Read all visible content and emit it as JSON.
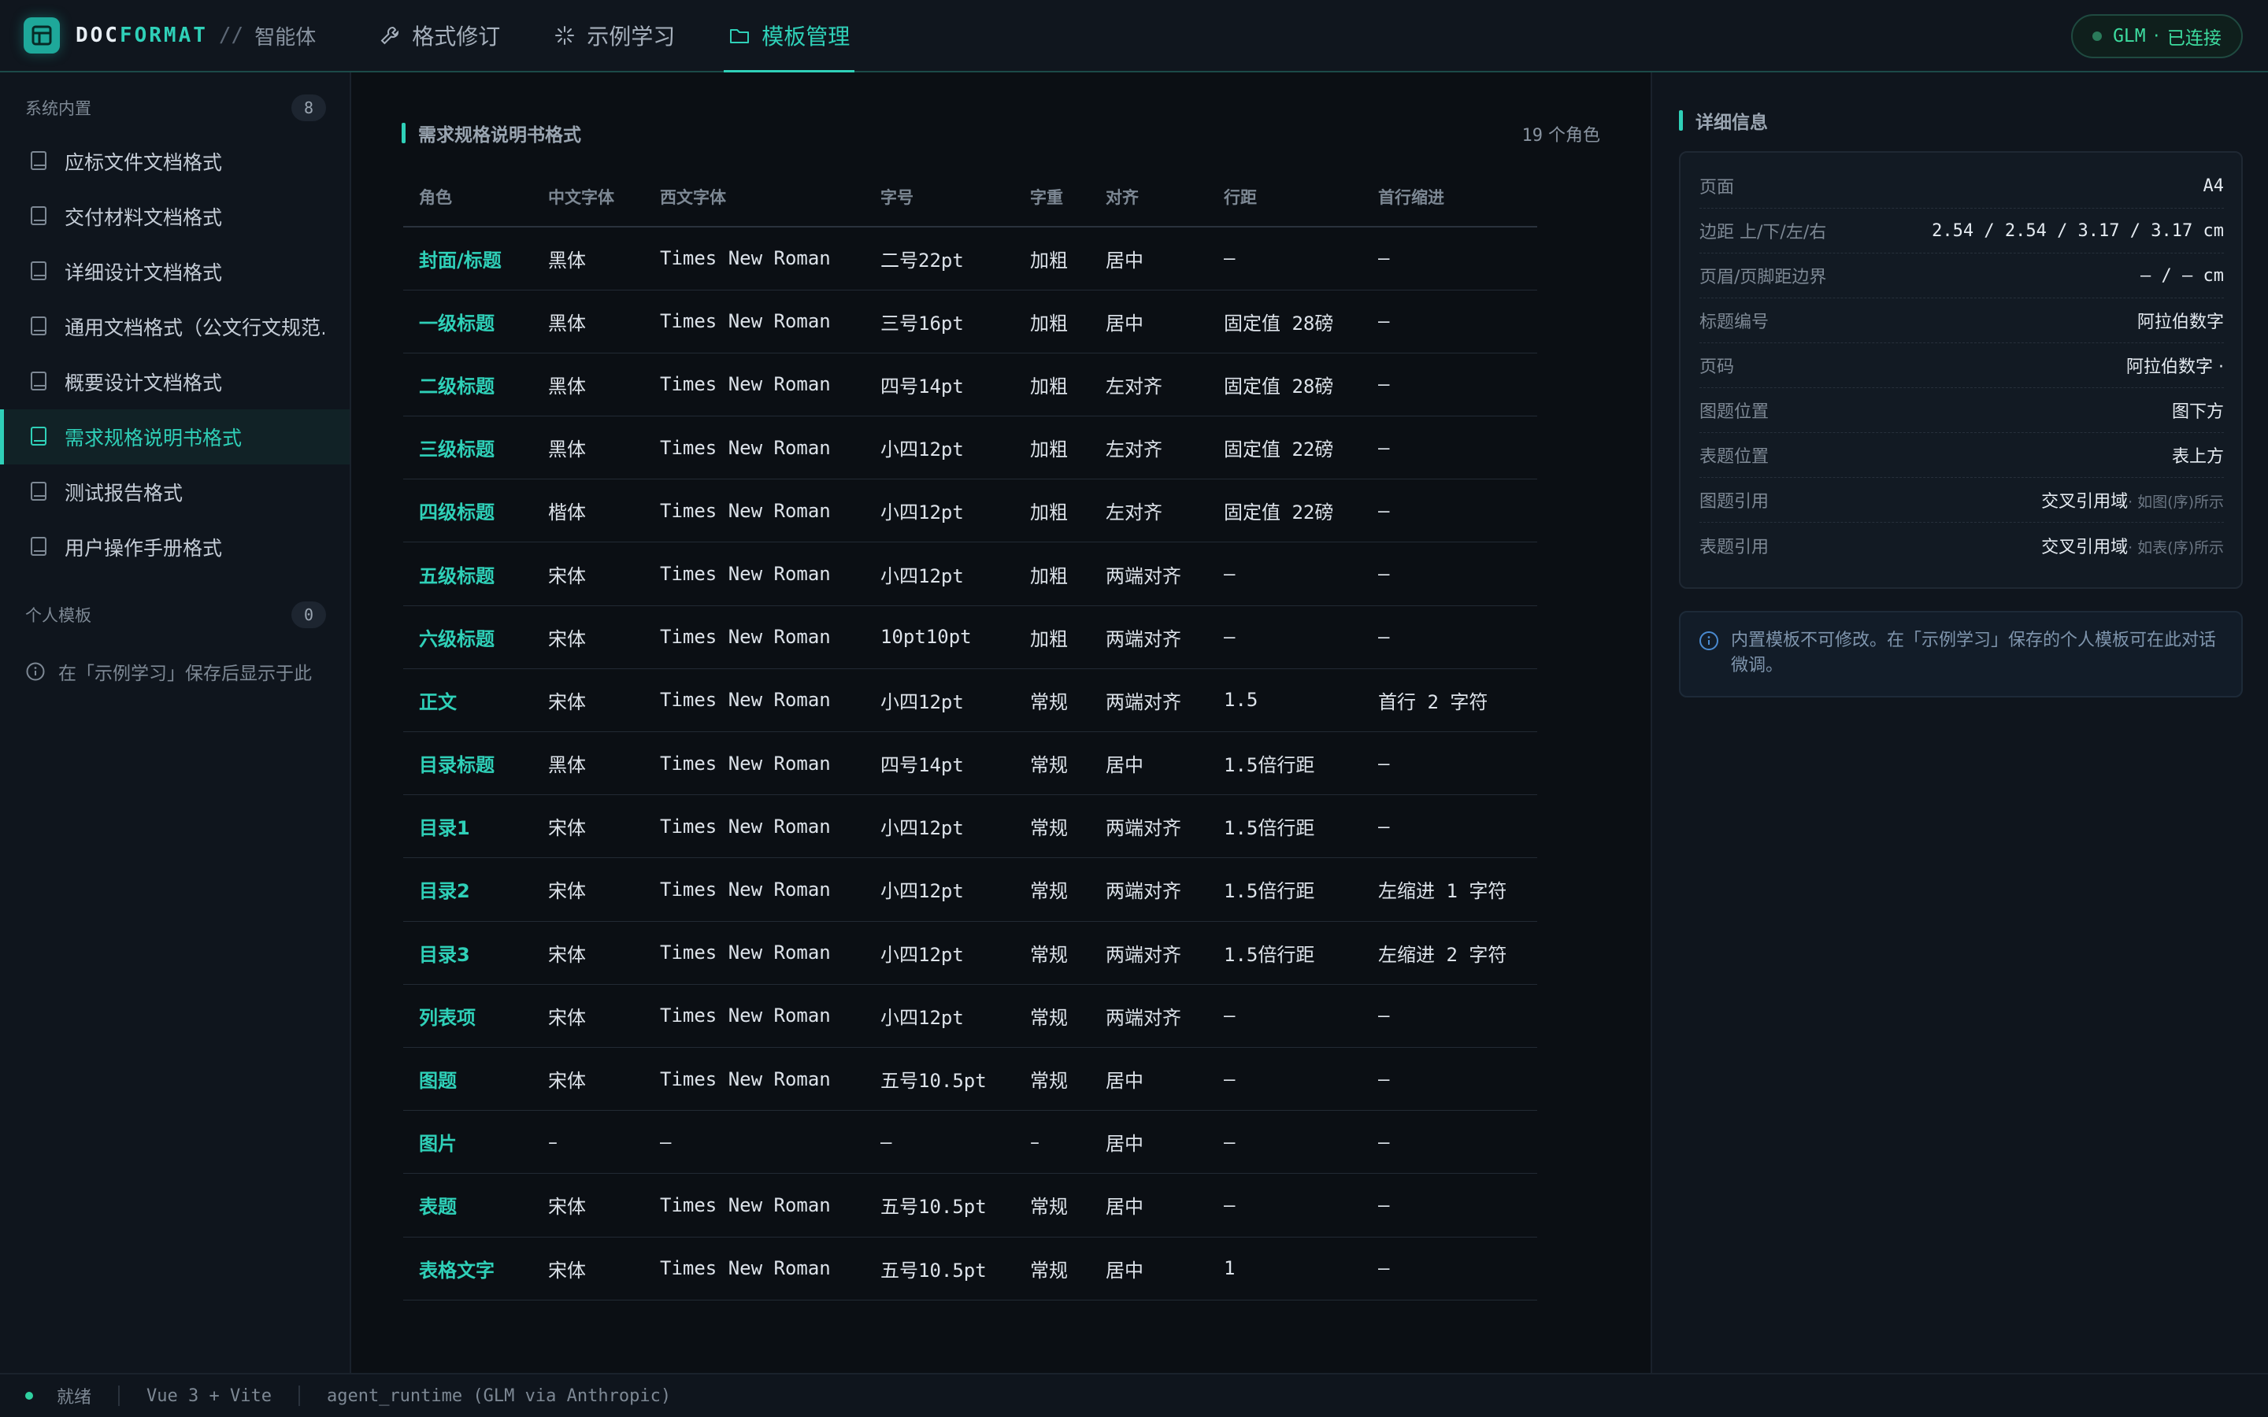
{
  "brand": {
    "name_a": "DOC",
    "name_b": "FORMAT",
    "sep": "//",
    "sub": "智能体"
  },
  "tabs": [
    {
      "label": "格式修订",
      "icon": "wrench-icon"
    },
    {
      "label": "示例学习",
      "icon": "sparkle-icon"
    },
    {
      "label": "模板管理",
      "icon": "folder-icon",
      "active": true
    }
  ],
  "connection": {
    "model": "GLM",
    "sep": "·",
    "status": "已连接"
  },
  "sidebar": {
    "system_header": "系统内置",
    "system_count": "8",
    "items": [
      {
        "label": "应标文件文档格式"
      },
      {
        "label": "交付材料文档格式"
      },
      {
        "label": "详细设计文档格式"
      },
      {
        "label": "通用文档格式（公文行文规范…"
      },
      {
        "label": "概要设计文档格式"
      },
      {
        "label": "需求规格说明书格式",
        "active": true
      },
      {
        "label": "测试报告格式"
      },
      {
        "label": "用户操作手册格式"
      }
    ],
    "personal_header": "个人模板",
    "personal_count": "0",
    "personal_hint": "在「示例学习」保存后显示于此"
  },
  "main": {
    "title": "需求规格说明书格式",
    "role_count": "19",
    "role_count_suffix": "个角色",
    "columns": [
      "角色",
      "中文字体",
      "西文字体",
      "字号",
      "字重",
      "对齐",
      "行距",
      "首行缩进"
    ],
    "rows": [
      [
        "封面/标题",
        "黑体",
        "Times New Roman",
        "二号22pt",
        "加粗",
        "居中",
        "–",
        "–"
      ],
      [
        "一级标题",
        "黑体",
        "Times New Roman",
        "三号16pt",
        "加粗",
        "居中",
        "固定值 28磅",
        "–"
      ],
      [
        "二级标题",
        "黑体",
        "Times New Roman",
        "四号14pt",
        "加粗",
        "左对齐",
        "固定值 28磅",
        "–"
      ],
      [
        "三级标题",
        "黑体",
        "Times New Roman",
        "小四12pt",
        "加粗",
        "左对齐",
        "固定值 22磅",
        "–"
      ],
      [
        "四级标题",
        "楷体",
        "Times New Roman",
        "小四12pt",
        "加粗",
        "左对齐",
        "固定值 22磅",
        "–"
      ],
      [
        "五级标题",
        "宋体",
        "Times New Roman",
        "小四12pt",
        "加粗",
        "两端对齐",
        "–",
        "–"
      ],
      [
        "六级标题",
        "宋体",
        "Times New Roman",
        "10pt10pt",
        "加粗",
        "两端对齐",
        "–",
        "–"
      ],
      [
        "正文",
        "宋体",
        "Times New Roman",
        "小四12pt",
        "常规",
        "两端对齐",
        "1.5",
        "首行 2 字符"
      ],
      [
        "目录标题",
        "黑体",
        "Times New Roman",
        "四号14pt",
        "常规",
        "居中",
        "1.5倍行距",
        "–"
      ],
      [
        "目录1",
        "宋体",
        "Times New Roman",
        "小四12pt",
        "常规",
        "两端对齐",
        "1.5倍行距",
        "–"
      ],
      [
        "目录2",
        "宋体",
        "Times New Roman",
        "小四12pt",
        "常规",
        "两端对齐",
        "1.5倍行距",
        "左缩进 1 字符"
      ],
      [
        "目录3",
        "宋体",
        "Times New Roman",
        "小四12pt",
        "常规",
        "两端对齐",
        "1.5倍行距",
        "左缩进 2 字符"
      ],
      [
        "列表项",
        "宋体",
        "Times New Roman",
        "小四12pt",
        "常规",
        "两端对齐",
        "–",
        "–"
      ],
      [
        "图题",
        "宋体",
        "Times New Roman",
        "五号10.5pt",
        "常规",
        "居中",
        "–",
        "–"
      ],
      [
        "图片",
        "–",
        "–",
        "–",
        "–",
        "居中",
        "–",
        "–"
      ],
      [
        "表题",
        "宋体",
        "Times New Roman",
        "五号10.5pt",
        "常规",
        "居中",
        "–",
        "–"
      ],
      [
        "表格文字",
        "宋体",
        "Times New Roman",
        "五号10.5pt",
        "常规",
        "居中",
        "1",
        "–"
      ]
    ]
  },
  "detail": {
    "title": "详细信息",
    "rows": [
      {
        "label": "页面",
        "value": "A4",
        "mono": true
      },
      {
        "label": "边距 上/下/左/右",
        "value": "2.54 / 2.54 / 3.17 / 3.17 cm",
        "mono": true
      },
      {
        "label": "页眉/页脚距边界",
        "value": "– / – cm",
        "mono": true
      },
      {
        "label": "标题编号",
        "value": "阿拉伯数字"
      },
      {
        "label": "页码",
        "value": "阿拉伯数字 ·"
      },
      {
        "label": "图题位置",
        "value": "图下方"
      },
      {
        "label": "表题位置",
        "value": "表上方"
      },
      {
        "label": "图题引用",
        "value": "交叉引用域",
        "sub": "· 如图(序)所示"
      },
      {
        "label": "表题引用",
        "value": "交叉引用域",
        "sub": "· 如表(序)所示"
      }
    ],
    "note": "内置模板不可修改。在「示例学习」保存的个人模板可在此对话微调。"
  },
  "status": {
    "state": "就绪",
    "stack": "Vue 3 + Vite",
    "runtime": "agent_runtime (GLM via Anthropic)"
  },
  "colors": {
    "accent": "#2fd0b8",
    "background": "#0b0f14",
    "panel": "#0f151d"
  }
}
